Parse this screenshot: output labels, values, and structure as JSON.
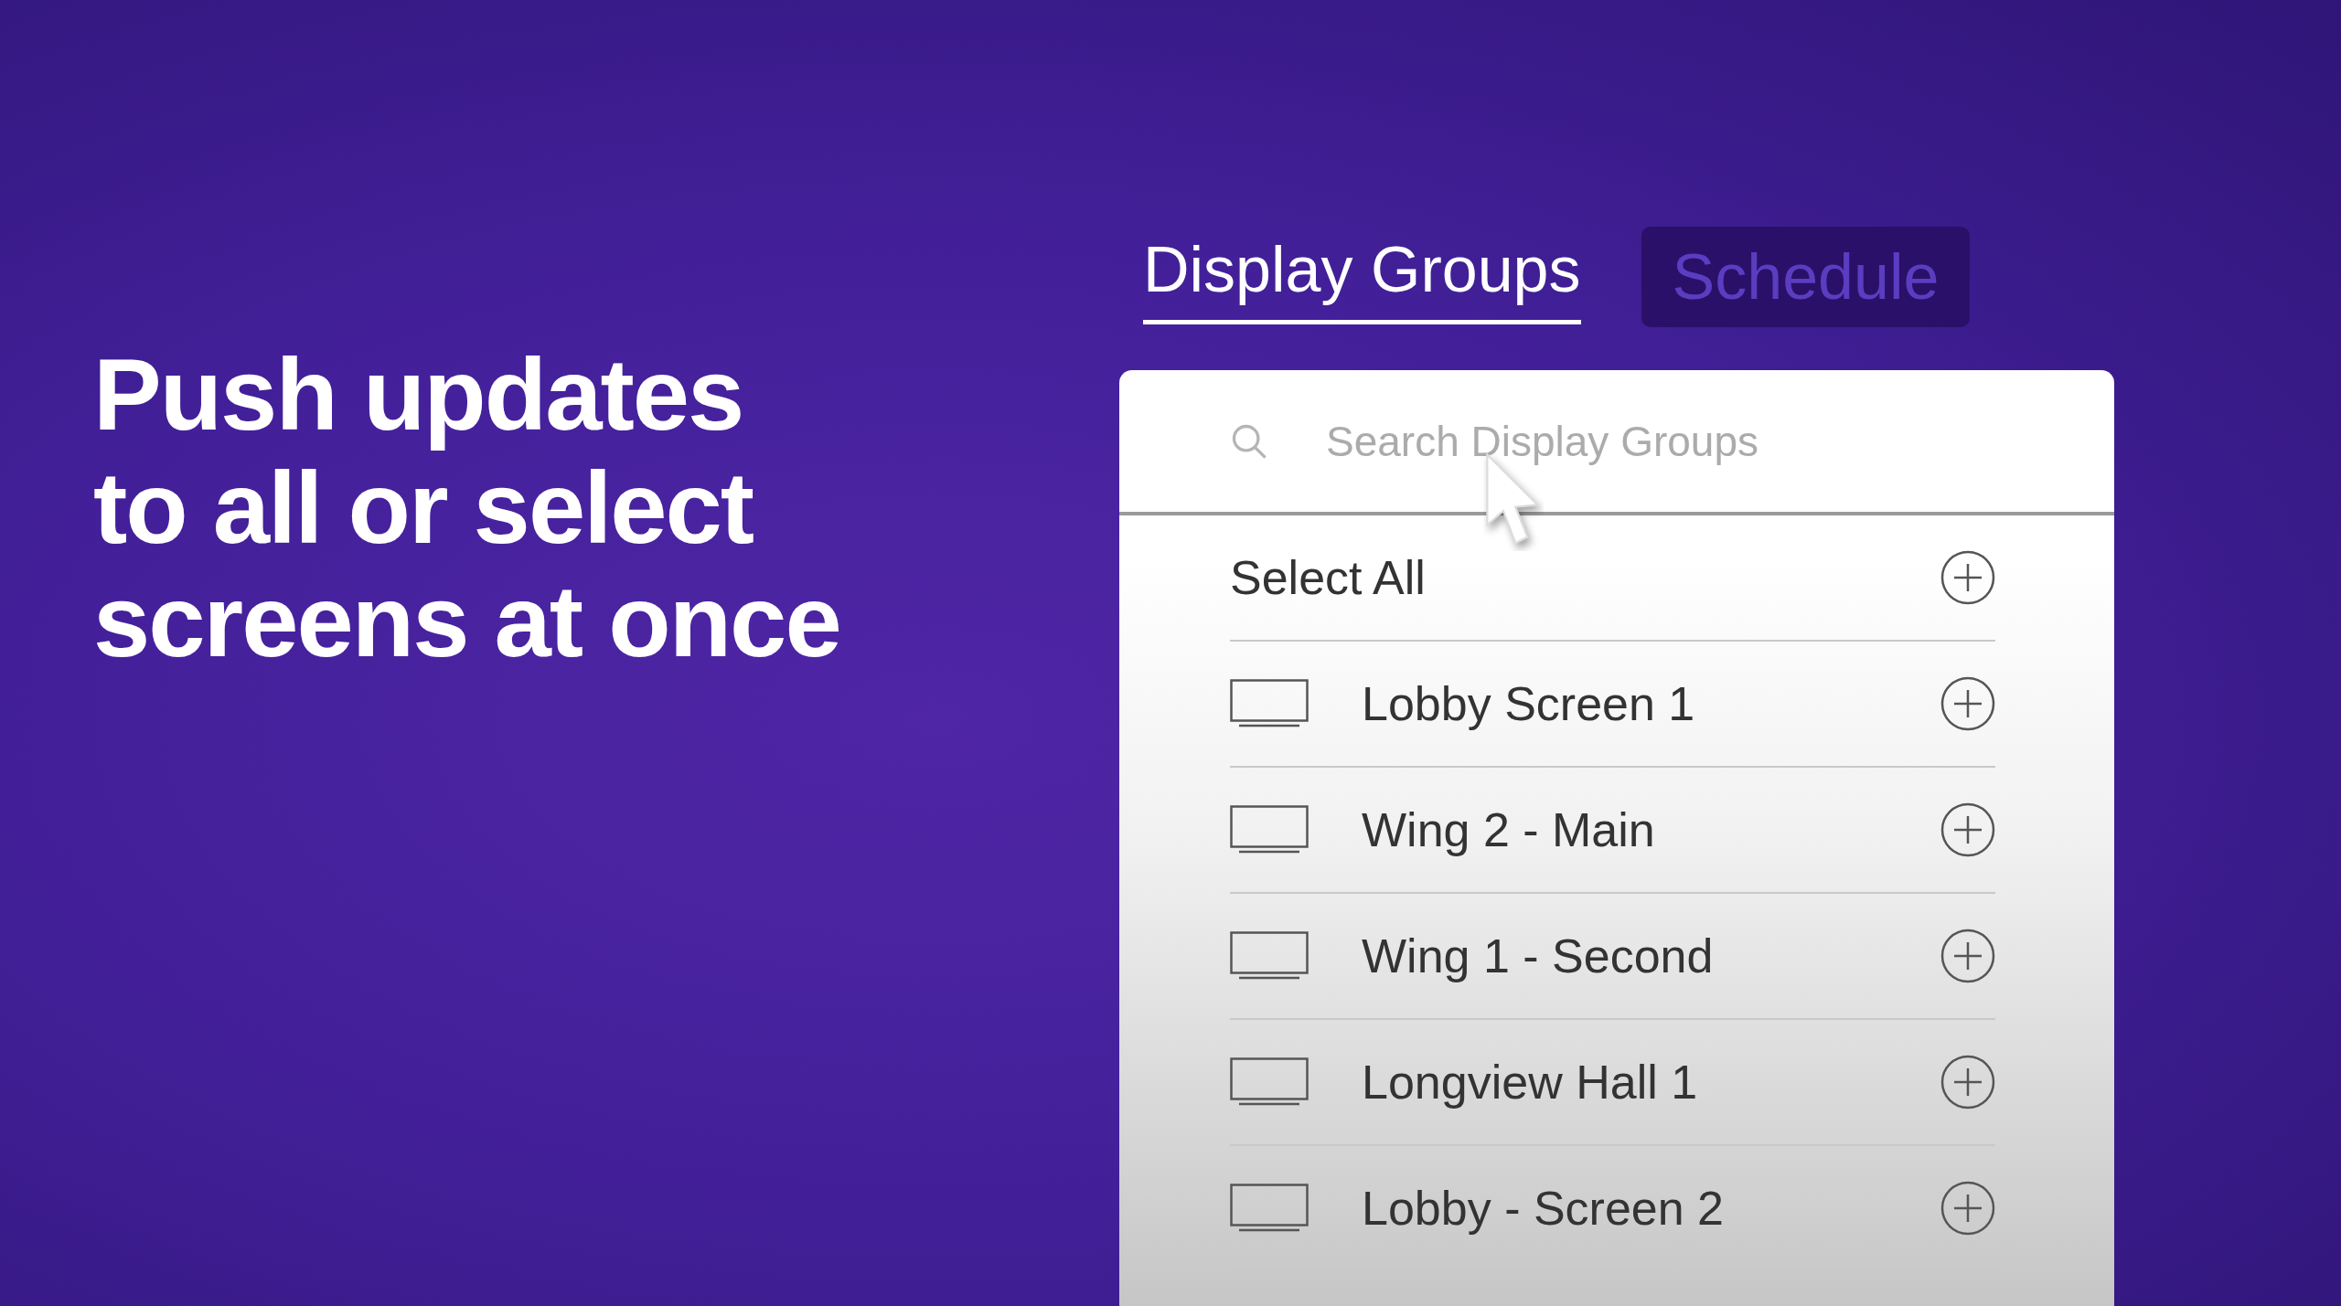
{
  "headline": [
    "Push updates",
    "to all or select",
    "screens at once"
  ],
  "tabs": [
    {
      "label": "Display Groups",
      "selected": true
    },
    {
      "label": "Schedule",
      "selected": false
    }
  ],
  "search": {
    "placeholder": "Search Display Groups"
  },
  "select_all": {
    "label": "Select All"
  },
  "groups": [
    {
      "name": "Lobby Screen 1"
    },
    {
      "name": "Wing 2 - Main"
    },
    {
      "name": "Wing 1 - Second"
    },
    {
      "name": "Longview Hall 1"
    },
    {
      "name": "Lobby - Screen 2"
    }
  ]
}
